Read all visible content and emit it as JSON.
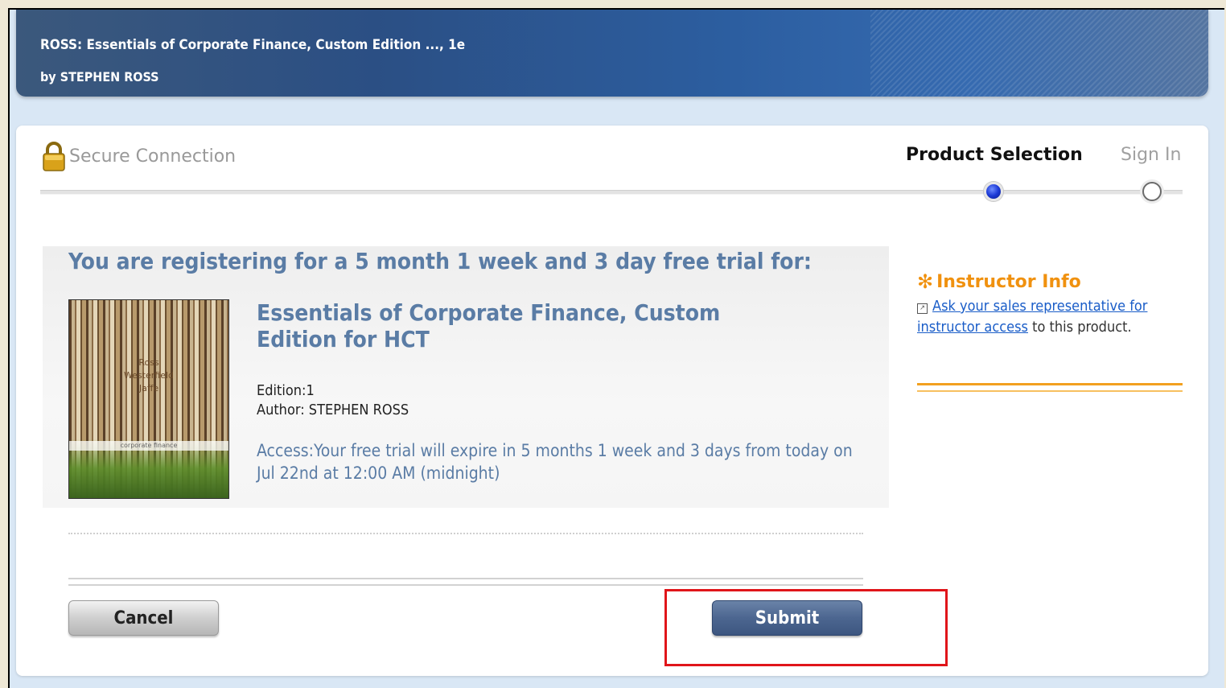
{
  "header": {
    "title": "ROSS: Essentials of Corporate Finance, Custom Edition ..., 1e",
    "byline": "by STEPHEN ROSS"
  },
  "secure": {
    "label": "Secure Connection",
    "icon": "lock-icon"
  },
  "steps": [
    {
      "label": "Product Selection",
      "active": true
    },
    {
      "label": "Sign In",
      "active": false
    }
  ],
  "trial": {
    "heading": "You are registering for a 5 month 1 week and 3 day free trial for:",
    "book_title": "Essentials of Corporate Finance, Custom Edition for HCT",
    "edition_line": "Edition:1",
    "author_line": "Author: STEPHEN ROSS",
    "access_line": "Access:Your free trial will expire in 5 months 1 week and 3 days from today on Jul 22nd at 12:00 AM (midnight)",
    "cover": {
      "authors": [
        "Ross",
        "Westerfield",
        "Jaffe"
      ],
      "band_text": "corporate finance"
    }
  },
  "buttons": {
    "cancel": "Cancel",
    "submit": "Submit"
  },
  "instructor": {
    "title": "Instructor Info",
    "link_text": "Ask your sales representative for instructor access",
    "trailing_text": " to this product."
  },
  "colors": {
    "accent_blue": "#5a7ca5",
    "orange": "#f0910f",
    "highlight_red": "#e0151a"
  }
}
